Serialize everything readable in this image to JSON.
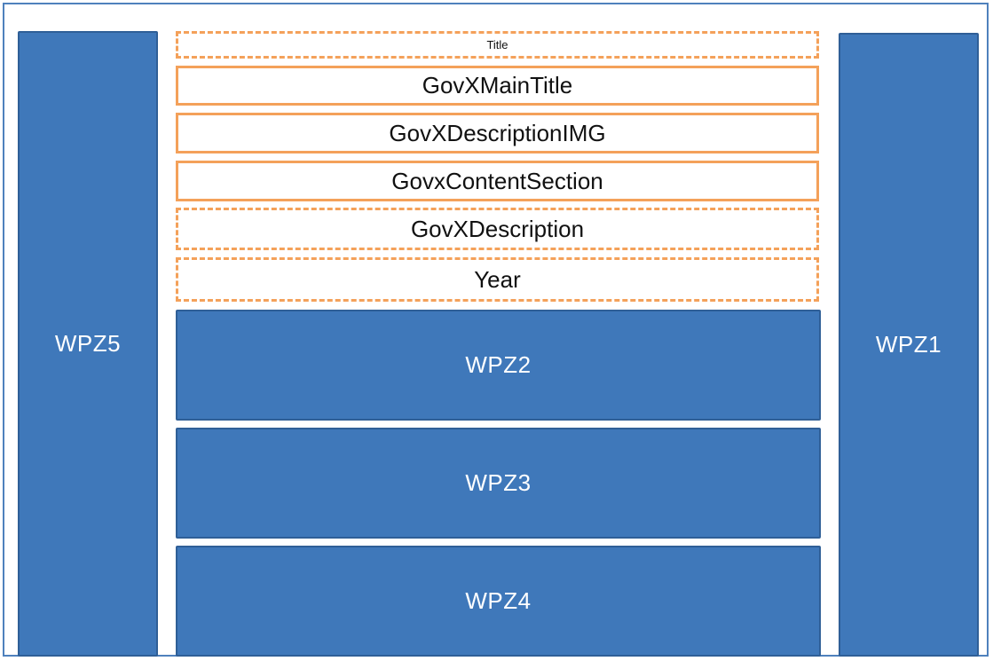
{
  "zones": {
    "left": "WPZ5",
    "right": "WPZ1",
    "middle_top": "WPZ2",
    "middle_mid": "WPZ3",
    "middle_bottom": "WPZ4"
  },
  "fields": {
    "title": "Title",
    "main_title": "GovXMainTitle",
    "description_img": "GovXDescriptionIMG",
    "content_section": "GovxContentSection",
    "description": "GovXDescription",
    "year": "Year"
  },
  "colors": {
    "zone_fill": "#3f78ba",
    "field_border": "#f4a15a",
    "frame_border": "#4f81bd"
  }
}
